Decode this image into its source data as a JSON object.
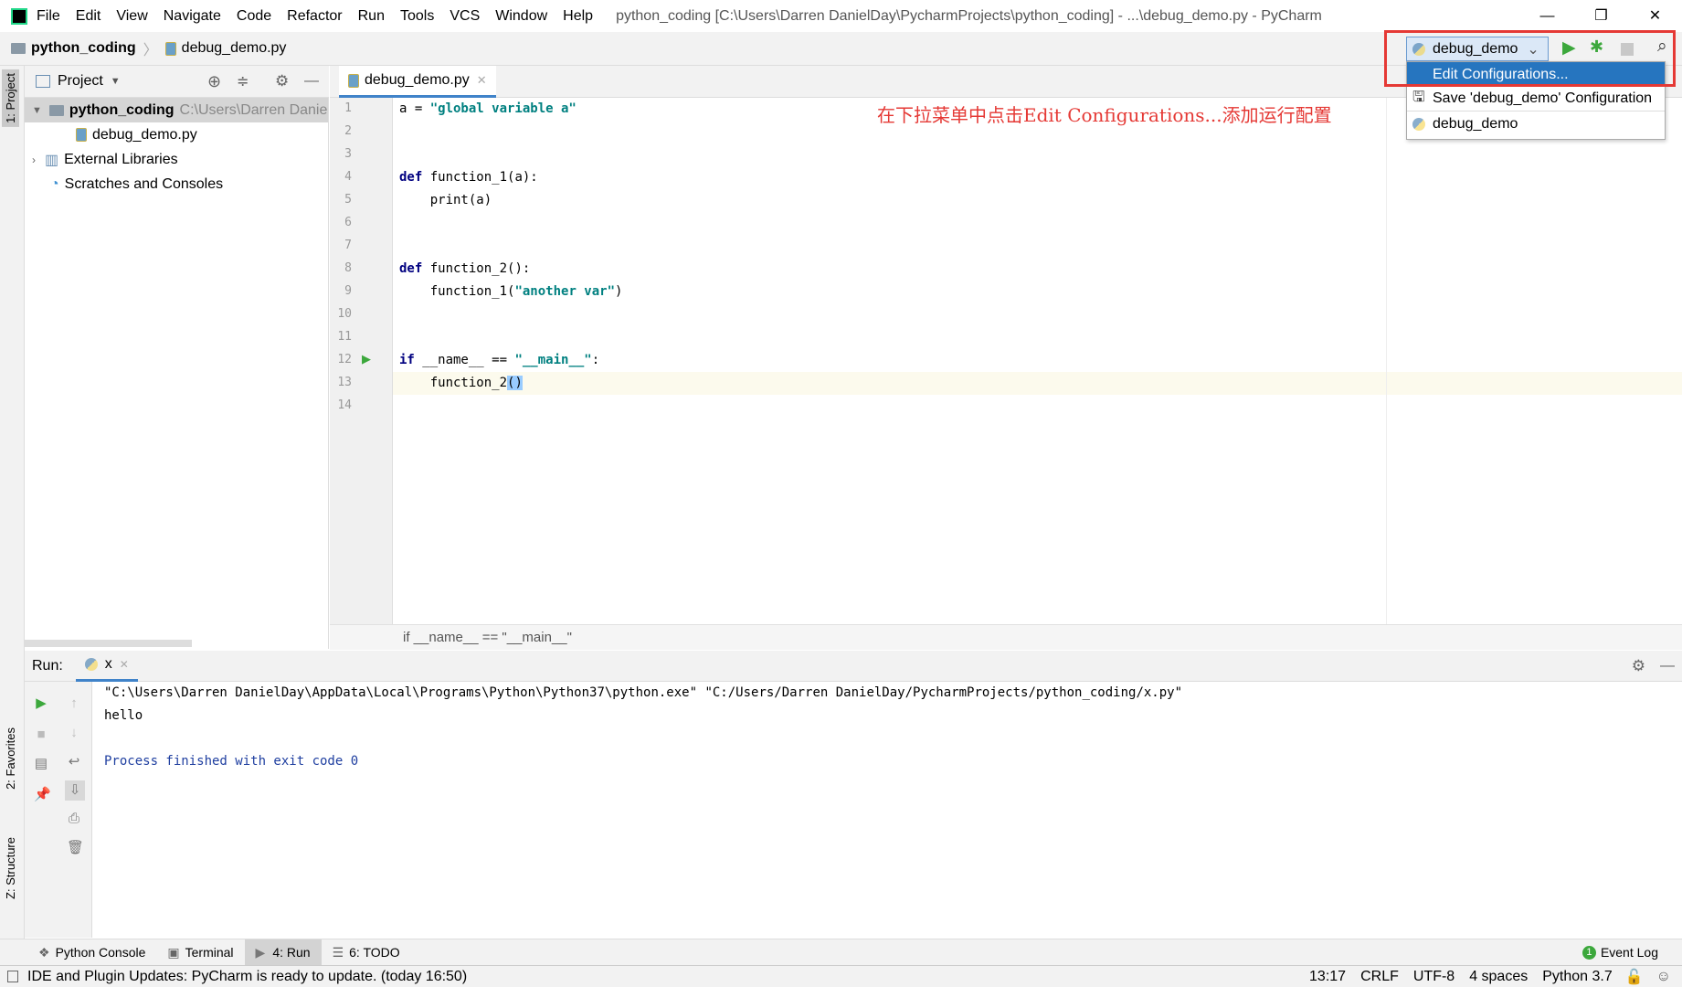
{
  "menu": [
    "File",
    "Edit",
    "View",
    "Navigate",
    "Code",
    "Refactor",
    "Run",
    "Tools",
    "VCS",
    "Window",
    "Help"
  ],
  "window_title": "python_coding [C:\\Users\\Darren DanielDay\\PycharmProjects\\python_coding] - ...\\debug_demo.py - PyCharm",
  "window_controls": {
    "minimize": "—",
    "restore": "❐",
    "close": "✕"
  },
  "breadcrumb": {
    "project": "python_coding",
    "file": "debug_demo.py"
  },
  "run_config": {
    "selected": "debug_demo"
  },
  "dropdown": {
    "items": [
      "Edit Configurations...",
      "Save 'debug_demo' Configuration",
      "debug_demo"
    ],
    "highlighted": 0
  },
  "annotation": "在下拉菜单中点击Edit Configurations...添加运行配置",
  "project_panel": {
    "title": "Project",
    "root": "python_coding",
    "root_path": "C:\\Users\\Darren Danie",
    "file": "debug_demo.py",
    "external": "External Libraries",
    "scratches": "Scratches and Consoles"
  },
  "side_tabs": {
    "project": "1: Project",
    "favorites": "2: Favorites",
    "structure": "Z: Structure"
  },
  "editor": {
    "tab": "debug_demo.py",
    "line_numbers": [
      "1",
      "2",
      "3",
      "4",
      "5",
      "6",
      "7",
      "8",
      "9",
      "10",
      "11",
      "12",
      "13",
      "14"
    ],
    "current_line": 13,
    "crumb": "if __name__ == \"__main__\""
  },
  "run_panel": {
    "label": "Run:",
    "tab": "x",
    "lines": [
      "\"C:\\Users\\Darren DanielDay\\AppData\\Local\\Programs\\Python\\Python37\\python.exe\" \"C:/Users/Darren DanielDay/PycharmProjects/python_coding/x.py\"",
      "hello",
      "",
      "Process finished with exit code 0"
    ]
  },
  "bottom_tabs": [
    "Python Console",
    "Terminal",
    "4: Run",
    "6: TODO"
  ],
  "event_log": {
    "label": "Event Log",
    "count": "1"
  },
  "status": {
    "message": "IDE and Plugin Updates: PyCharm is ready to update. (today 16:50)",
    "position": "13:17",
    "line_sep": "CRLF",
    "encoding": "UTF-8",
    "indent": "4 spaces",
    "interpreter": "Python 3.7"
  },
  "colors": {
    "accent": "#2675bf",
    "annotation": "#e53935",
    "run_green": "#3ca83c"
  }
}
